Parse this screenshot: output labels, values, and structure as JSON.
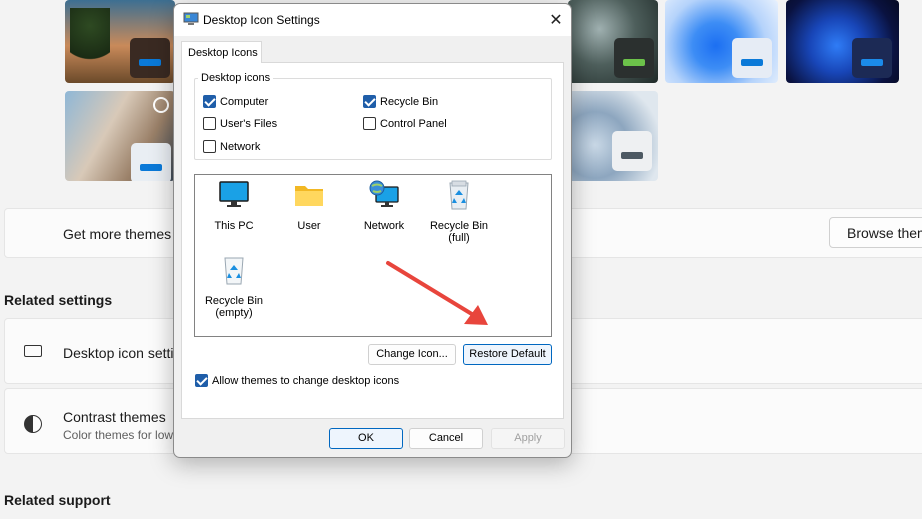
{
  "settings": {
    "get_more_themes": "Get more themes",
    "browse_themes": "Browse them",
    "related_settings": "Related settings",
    "desktop_icon_settings": "Desktop icon setti",
    "contrast_themes": "Contrast themes",
    "contrast_sub": "Color themes for low",
    "related_support": "Related support"
  },
  "dialog": {
    "title": "Desktop Icon Settings",
    "close": "✕",
    "tab": "Desktop Icons",
    "group_label": "Desktop icons",
    "checkboxes": {
      "computer": {
        "label": "Computer",
        "checked": true
      },
      "recycle_bin": {
        "label": "Recycle Bin",
        "checked": true
      },
      "users_files": {
        "label": "User's Files",
        "checked": false
      },
      "control_panel": {
        "label": "Control Panel",
        "checked": false
      },
      "network": {
        "label": "Network",
        "checked": false
      }
    },
    "icons": {
      "this_pc": "This PC",
      "user": "User",
      "network": "Network",
      "recycle_full_1": "Recycle Bin",
      "recycle_full_2": "(full)",
      "recycle_empty_1": "Recycle Bin",
      "recycle_empty_2": "(empty)"
    },
    "change_icon": "Change Icon...",
    "restore_default": "Restore Default",
    "allow_themes": {
      "label": "Allow themes to change desktop icons",
      "checked": true
    },
    "ok": "OK",
    "cancel": "Cancel",
    "apply": "Apply"
  },
  "colors": {
    "accent": "#0067c0",
    "annotation_arrow": "#e8453c"
  }
}
